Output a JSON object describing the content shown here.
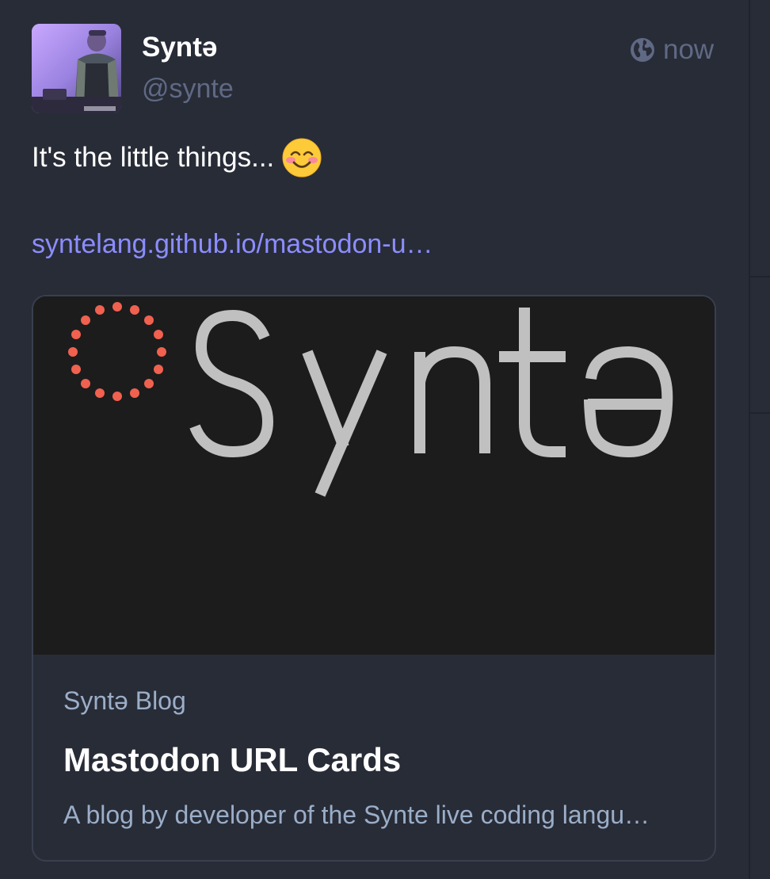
{
  "post": {
    "author": {
      "display_name": "Syntə",
      "handle": "@synte",
      "avatar_icon": "avatar-photo"
    },
    "visibility_icon": "globe-icon",
    "timestamp": "now",
    "text": "It's the little things...",
    "emoji": "smiling-face-with-smiling-eyes",
    "link_text": "syntelang.github.io/mastodon-u…"
  },
  "card": {
    "image_logo_text": "Syntə",
    "provider": "Syntə Blog",
    "title": "Mastodon URL Cards",
    "description": "A blog by developer of the Synte live coding langu…"
  },
  "colors": {
    "background": "#282c37",
    "link": "#8c8dff",
    "muted": "#606984",
    "card_muted": "#9baec8",
    "logo_dots": "#f0614f",
    "logo_text": "#c0c0c0"
  }
}
